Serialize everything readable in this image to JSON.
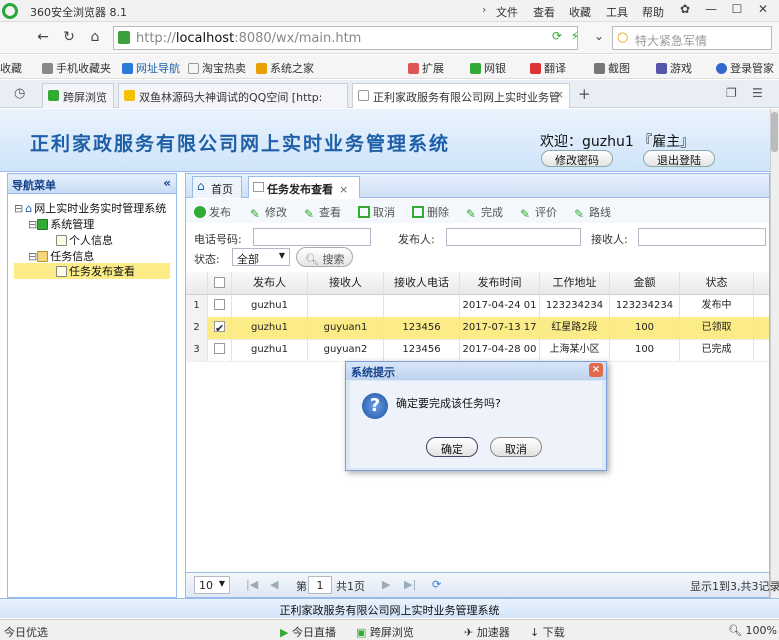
{
  "browser": {
    "title": "360安全浏览器 8.1",
    "menus": [
      "文件",
      "查看",
      "收藏",
      "工具",
      "帮助"
    ],
    "url_host": "localhost",
    "url_rest": ":8080/wx/main.htm",
    "url_prefix": "http://",
    "search_placeholder": "特大紧急军情",
    "bookmarks": [
      "收藏",
      "手机收藏夹",
      "网址导航",
      "淘宝热卖",
      "系统之家",
      "扩展",
      "网银",
      "翻译",
      "截图",
      "游戏",
      "登录管家"
    ],
    "tabs": [
      {
        "label": "跨屏浏览"
      },
      {
        "label": "双鱼林源码大神调试的QQ空间 [http:"
      },
      {
        "label": "正利家政服务有限公司网上实时业务管"
      }
    ]
  },
  "app": {
    "title": "正利家政服务有限公司网上实时业务管理系统",
    "welcome": "欢迎：guzhu1 『雇主』",
    "change_password": "修改密码",
    "logout": "退出登陆",
    "footer": "正利家政服务有限公司网上实时业务管理系统"
  },
  "nav": {
    "header": "导航菜单",
    "collapse": "«",
    "root": "网上实时业务实时管理系统",
    "system": "系统管理",
    "personal": "个人信息",
    "task": "任务信息",
    "task_view": "任务发布查看"
  },
  "main": {
    "tabs": {
      "home": "首页",
      "task_view": "任务发布查看"
    },
    "toolbar": [
      "发布",
      "修改",
      "查看",
      "取消",
      "删除",
      "完成",
      "评价",
      "路线"
    ],
    "filters": {
      "phone_label": "电话号码:",
      "publisher_label": "发布人:",
      "receiver_label": "接收人:",
      "status_label": "状态:",
      "status_value": "全部",
      "search": "搜索"
    },
    "columns": [
      "发布人",
      "接收人",
      "接收人电话",
      "发布时间",
      "工作地址",
      "金额",
      "状态"
    ],
    "rows": [
      {
        "num": "1",
        "checked": false,
        "publisher": "guzhu1",
        "receiver": "",
        "phone": "",
        "time": "2017-04-24 01",
        "address": "123234234",
        "amount": "123234234",
        "status": "发布中"
      },
      {
        "num": "2",
        "checked": true,
        "publisher": "guzhu1",
        "receiver": "guyuan1",
        "phone": "123456",
        "time": "2017-07-13 17",
        "address": "红星路2段",
        "amount": "100",
        "status": "已领取"
      },
      {
        "num": "3",
        "checked": false,
        "publisher": "guzhu1",
        "receiver": "guyuan2",
        "phone": "123456",
        "time": "2017-04-28 00",
        "address": "上海某小区",
        "amount": "100",
        "status": "已完成"
      }
    ],
    "pager": {
      "page_size": "10",
      "page_prefix": "第",
      "page_value": "1",
      "page_total": "共1页",
      "summary": "显示1到3,共3记录"
    }
  },
  "dialog": {
    "title": "系统提示",
    "close": "×",
    "message": "确定要完成该任务吗?",
    "confirm": "确定",
    "cancel": "取消"
  },
  "status": {
    "left": "今日优选",
    "items": [
      "今日直播",
      "跨屏浏览",
      "加速器",
      "下载"
    ],
    "zoom": "100%"
  }
}
